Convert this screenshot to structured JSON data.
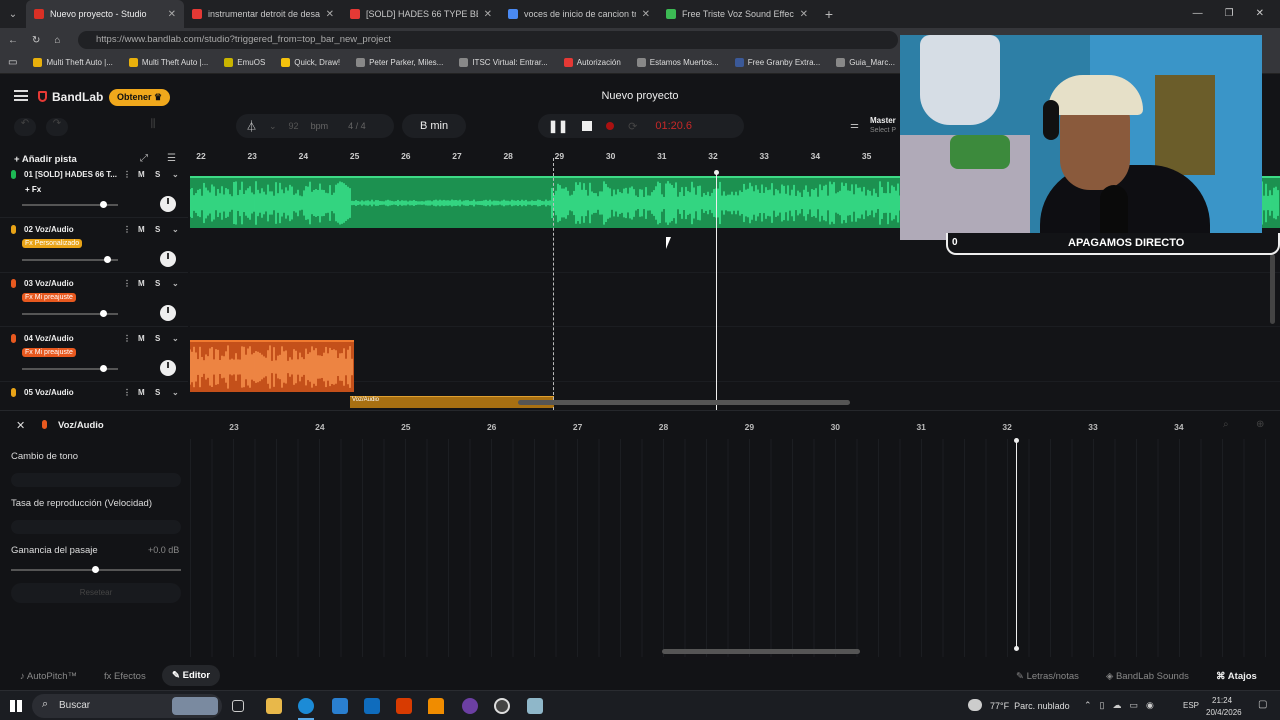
{
  "browser": {
    "tabs": [
      {
        "title": "Nuevo proyecto - Studio",
        "color": "#d93025",
        "active": true
      },
      {
        "title": "instrumentar detroit de desamor",
        "color": "#e53935",
        "active": false
      },
      {
        "title": "[SOLD] HADES 66 TYPE BEAT – \"I",
        "color": "#e53935",
        "active": false
      },
      {
        "title": "voces de inicio de cancion triste",
        "color": "#4a8af4",
        "active": false
      },
      {
        "title": "Free Triste Voz Sound Effects Dow",
        "color": "#3cba54",
        "active": false
      }
    ],
    "url": "https://www.bandlab.com/studio?triggered_from=top_bar_new_project",
    "bookmarks": [
      {
        "label": "Multi Theft Auto |...",
        "color": "#e8b00c"
      },
      {
        "label": "Multi Theft Auto |...",
        "color": "#e8b00c"
      },
      {
        "label": "EmuOS",
        "color": "#c9b400"
      },
      {
        "label": "Quick, Draw!",
        "color": "#f4c20d"
      },
      {
        "label": "Peter Parker, Miles...",
        "color": "#888"
      },
      {
        "label": "ITSC Virtual: Entrar...",
        "color": "#888"
      },
      {
        "label": "Autorización",
        "color": "#e53935"
      },
      {
        "label": "Estamos Muertos...",
        "color": "#888"
      },
      {
        "label": "Free Granby Extra...",
        "color": "#3b5998"
      },
      {
        "label": "Guia_Marc...",
        "color": "#888"
      }
    ]
  },
  "app": {
    "brand": "BandLab",
    "obtener": "Obtener",
    "project_title": "Nuevo proyecto",
    "bpm_value": "92",
    "bpm_label": "bpm",
    "time_sig": "4 / 4",
    "key": "B min",
    "time": "01:20.6",
    "master": "Master",
    "master_sub": "Select P",
    "add_track": "Añadir pista",
    "ruler": [
      "22",
      "23",
      "24",
      "25",
      "26",
      "27",
      "28",
      "29",
      "30",
      "31",
      "32",
      "33",
      "34",
      "35"
    ],
    "tracks": [
      {
        "num": "01",
        "name": "[SOLD] HADES 66 T...",
        "fx": "+ Fx",
        "fx_color": "none",
        "mic": "#1db954",
        "vol": 0.85
      },
      {
        "num": "02",
        "name": "Voz/Audio",
        "fx": "Fx Personalizado",
        "fx_color": "#e8a317",
        "mic": "#e8a317",
        "vol": 0.9
      },
      {
        "num": "03",
        "name": "Voz/Audio",
        "fx": "Fx Mi preajuste",
        "fx_color": "#e8591f",
        "mic": "#e8591f",
        "vol": 0.85
      },
      {
        "num": "04",
        "name": "Voz/Audio",
        "fx": "Fx Mi preajuste",
        "fx_color": "#e8591f",
        "mic": "#e8591f",
        "vol": 0.85
      },
      {
        "num": "05",
        "name": "Voz/Audio",
        "fx": "",
        "fx_color": "none",
        "mic": "#e8a317",
        "vol": 0.85
      }
    ],
    "m_label": "M",
    "s_label": "S",
    "clip5_label": "Voz/Audio",
    "editor": {
      "title": "Voz/Audio",
      "ruler": [
        "23",
        "24",
        "25",
        "26",
        "27",
        "28",
        "29",
        "30",
        "31",
        "32",
        "33",
        "34"
      ],
      "pitch_label": "Cambio de tono",
      "rate_label": "Tasa de reproducción (Velocidad)",
      "gain_label": "Ganancia del pasaje",
      "gain_value": "+0.0 dB",
      "gain_level": 0.5,
      "reset": "Resetear"
    },
    "bottom": {
      "autopitch": "AutoPitch™",
      "efectos": "Efectos",
      "editor": "Editor",
      "letras": "Letras/notas",
      "sounds": "BandLab Sounds",
      "atajos": "Atajos"
    }
  },
  "stream": {
    "counter": "0",
    "caption": "APAGAMOS DIRECTO"
  },
  "taskbar": {
    "search": "Buscar",
    "weather": "77°F  Parc. nublado",
    "lang": "ESP",
    "time": "21:24",
    "date": "20/4/2026"
  }
}
